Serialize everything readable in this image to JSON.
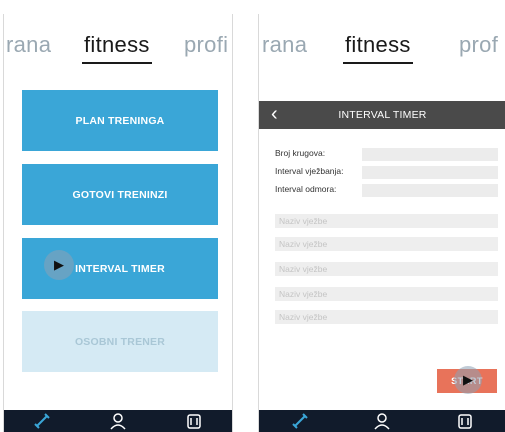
{
  "left": {
    "tabs": [
      "rana",
      "fitness",
      "profi"
    ],
    "active_tab": "fitness",
    "menu": [
      {
        "label": "PLAN TRENINGA",
        "enabled": true
      },
      {
        "label": "GOTOVI TRENINZI",
        "enabled": true
      },
      {
        "label": "INTERVAL TIMER",
        "enabled": true
      },
      {
        "label": "OSOBNI TRENER",
        "enabled": false
      }
    ]
  },
  "right": {
    "tabs": [
      "rana",
      "fitness",
      "prof"
    ],
    "active_tab": "fitness",
    "title": "INTERVAL TIMER",
    "fields": [
      {
        "label": "Broj krugova:",
        "value": ""
      },
      {
        "label": "Interval vježbanja:",
        "value": ""
      },
      {
        "label": "Interval odmora:",
        "value": ""
      }
    ],
    "exercise_placeholder": "Naziv vježbe",
    "exercises": [
      "Naziv vježbe",
      "Naziv vježbe",
      "Naziv vježbe",
      "Naziv vježbe",
      "Naziv vježbe"
    ],
    "start_label": "START"
  },
  "nav": {
    "icons": [
      "dumbbell-icon",
      "user-icon",
      "food-icon"
    ]
  },
  "colors": {
    "menu_blue": "#3aa6d7",
    "menu_disabled": "#d5eaf4",
    "nav_bg": "#111b2b",
    "titlebar_bg": "#4a4a4a",
    "start_orange": "#e8735a"
  }
}
